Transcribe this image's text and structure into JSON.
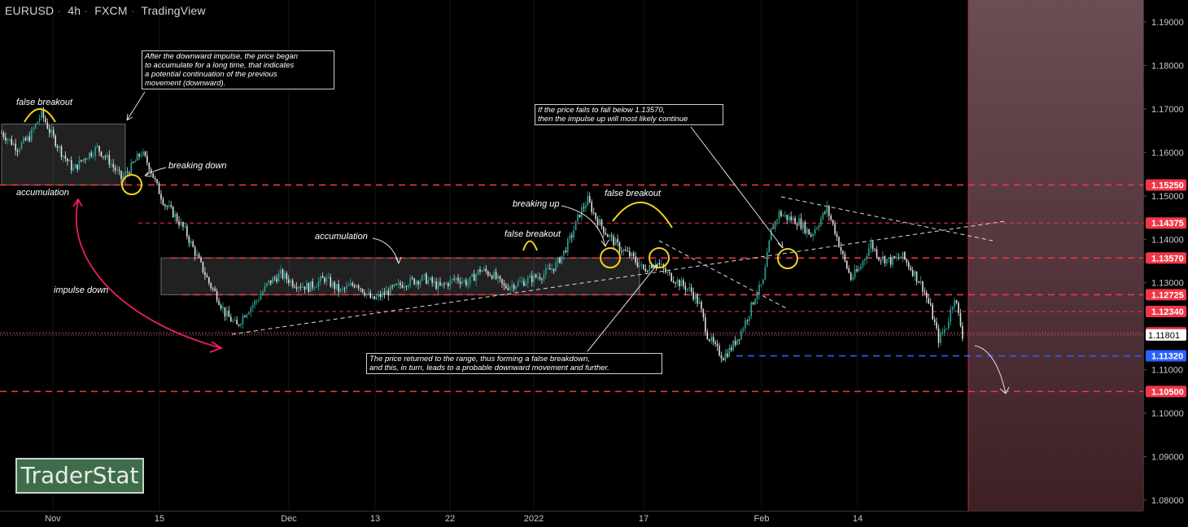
{
  "header": {
    "symbol": "EURUSD",
    "interval": "4h",
    "broker": "FXCM",
    "platform": "TradingView"
  },
  "logo": "TraderStat",
  "chart_data": {
    "type": "candlestick",
    "price_axis": {
      "ticks": [
        1.19,
        1.18,
        1.17,
        1.16,
        1.15,
        1.14,
        1.13,
        1.11,
        1.1,
        1.09,
        1.08
      ],
      "range": [
        1.079,
        1.194
      ]
    },
    "time_axis": {
      "labels": [
        "Nov",
        "15",
        "Dec",
        "13",
        "22",
        "2022",
        "17",
        "Feb",
        "14"
      ]
    },
    "levels": [
      {
        "price": 1.1525,
        "label": "1.15250",
        "color": "#f23645",
        "style": "dashed",
        "labelled": true
      },
      {
        "price": 1.14375,
        "label": "1.14375",
        "color": "#f23645",
        "style": "dashed-thin",
        "labelled": true
      },
      {
        "price": 1.1357,
        "label": "1.13570",
        "color": "#f23645",
        "style": "dashed",
        "labelled": true
      },
      {
        "price": 1.12725,
        "label": "1.12725",
        "color": "#f23645",
        "style": "dashed",
        "labelled": true
      },
      {
        "price": 1.1234,
        "label": "1.12340",
        "color": "#f23645",
        "style": "dashed-thin",
        "labelled": true
      },
      {
        "price": 1.1185,
        "label": "1.11850",
        "color": "#f23645",
        "style": "dotted",
        "labelled": true
      },
      {
        "price": 1.1132,
        "label": "1.11320",
        "color": "#2962ff",
        "style": "dashed",
        "labelled": true
      },
      {
        "price": 1.105,
        "label": "1.10500",
        "color": "#f23645",
        "style": "dashed",
        "labelled": true
      }
    ],
    "last_price": {
      "price": 1.11801,
      "label": "1.11801"
    },
    "path": [
      [
        0,
        1.1645
      ],
      [
        8,
        1.161
      ],
      [
        14,
        1.1635
      ],
      [
        20,
        1.169
      ],
      [
        24,
        1.165
      ],
      [
        30,
        1.16
      ],
      [
        36,
        1.156
      ],
      [
        42,
        1.159
      ],
      [
        48,
        1.161
      ],
      [
        54,
        1.158
      ],
      [
        60,
        1.154
      ],
      [
        64,
        1.156
      ],
      [
        70,
        1.16
      ],
      [
        74,
        1.157
      ],
      [
        78,
        1.152
      ],
      [
        82,
        1.148
      ],
      [
        86,
        1.146
      ],
      [
        92,
        1.142
      ],
      [
        96,
        1.138
      ],
      [
        100,
        1.134
      ],
      [
        104,
        1.13
      ],
      [
        108,
        1.127
      ],
      [
        112,
        1.123
      ],
      [
        118,
        1.12
      ],
      [
        122,
        1.123
      ],
      [
        128,
        1.126
      ],
      [
        134,
        1.13
      ],
      [
        140,
        1.132
      ],
      [
        146,
        1.13
      ],
      [
        154,
        1.129
      ],
      [
        162,
        1.131
      ],
      [
        170,
        1.128
      ],
      [
        178,
        1.13
      ],
      [
        186,
        1.126
      ],
      [
        194,
        1.128
      ],
      [
        202,
        1.13
      ],
      [
        212,
        1.131
      ],
      [
        220,
        1.129
      ],
      [
        228,
        1.131
      ],
      [
        234,
        1.13
      ],
      [
        240,
        1.133
      ],
      [
        246,
        1.132
      ],
      [
        252,
        1.129
      ],
      [
        260,
        1.13
      ],
      [
        266,
        1.131
      ],
      [
        272,
        1.132
      ],
      [
        278,
        1.134
      ],
      [
        282,
        1.137
      ],
      [
        286,
        1.141
      ],
      [
        290,
        1.146
      ],
      [
        294,
        1.149
      ],
      [
        298,
        1.145
      ],
      [
        304,
        1.141
      ],
      [
        310,
        1.138
      ],
      [
        316,
        1.136
      ],
      [
        322,
        1.133
      ],
      [
        328,
        1.135
      ],
      [
        334,
        1.132
      ],
      [
        340,
        1.13
      ],
      [
        346,
        1.128
      ],
      [
        350,
        1.125
      ],
      [
        354,
        1.118
      ],
      [
        358,
        1.115
      ],
      [
        362,
        1.113
      ],
      [
        366,
        1.115
      ],
      [
        370,
        1.118
      ],
      [
        374,
        1.122
      ],
      [
        378,
        1.127
      ],
      [
        382,
        1.13
      ],
      [
        386,
        1.142
      ],
      [
        390,
        1.146
      ],
      [
        394,
        1.145
      ],
      [
        400,
        1.144
      ],
      [
        406,
        1.141
      ],
      [
        410,
        1.144
      ],
      [
        414,
        1.147
      ],
      [
        418,
        1.142
      ],
      [
        422,
        1.136
      ],
      [
        426,
        1.131
      ],
      [
        430,
        1.133
      ],
      [
        436,
        1.139
      ],
      [
        440,
        1.136
      ],
      [
        446,
        1.135
      ],
      [
        452,
        1.136
      ],
      [
        458,
        1.132
      ],
      [
        462,
        1.129
      ],
      [
        466,
        1.124
      ],
      [
        470,
        1.117
      ],
      [
        474,
        1.12
      ],
      [
        478,
        1.127
      ],
      [
        482,
        1.118
      ]
    ],
    "zones": [
      {
        "name": "accumulation-box-1",
        "x": [
          0,
          62
        ],
        "price": [
          1.1525,
          1.1665
        ]
      },
      {
        "name": "accumulation-box-2",
        "x": [
          80,
          320
        ],
        "price": [
          1.12725,
          1.1357
        ]
      },
      {
        "name": "forecast-zone",
        "x": [
          482,
          540
        ],
        "price": [
          1.079,
          1.194
        ]
      }
    ],
    "annotations": [
      {
        "text": "false breakout"
      },
      {
        "text": "accumulation"
      },
      {
        "text": "breaking down"
      },
      {
        "text": "impulse down"
      },
      {
        "text": "accumulation"
      },
      {
        "text": "false breakout"
      },
      {
        "text": "breaking up"
      },
      {
        "text": "false breakout"
      }
    ],
    "notes": [
      {
        "text": "After the downward impulse, the price began\nto accumulate for a long time, that indicates\na potential continuation of the previous\nmovement (downward)."
      },
      {
        "text": "If the price fails to fall below 1.13570,\nthen the impulse up will most likely continue"
      },
      {
        "text": "The price returned to the range, thus forming a false breakdown,\nand this, in turn, leads to a probable downward movement and further."
      }
    ]
  }
}
